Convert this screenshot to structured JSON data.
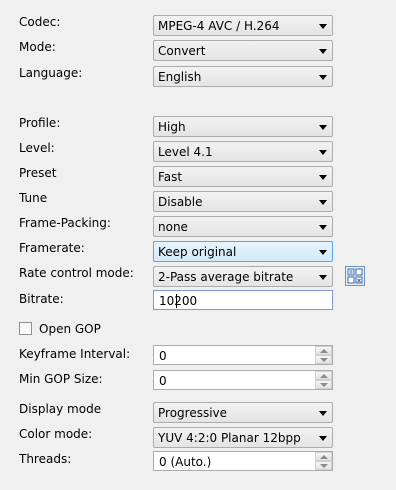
{
  "settings": {
    "codec": {
      "label": "Codec:",
      "value": "MPEG-4 AVC / H.264"
    },
    "mode": {
      "label": "Mode:",
      "value": "Convert"
    },
    "language": {
      "label": "Language:",
      "value": "English"
    },
    "profile": {
      "label": "Profile:",
      "value": "High"
    },
    "level": {
      "label": "Level:",
      "value": "Level 4.1"
    },
    "preset": {
      "label": "Preset",
      "value": "Fast"
    },
    "tune": {
      "label": "Tune",
      "value": "Disable"
    },
    "frame_packing": {
      "label": "Frame-Packing:",
      "value": "none"
    },
    "framerate": {
      "label": "Framerate:",
      "value": "Keep original"
    },
    "rate_control": {
      "label": "Rate control mode:",
      "value": "2-Pass average bitrate"
    },
    "bitrate": {
      "label": "Bitrate:",
      "value": "10200"
    },
    "open_gop": {
      "label": "Open GOP",
      "checked": false
    },
    "keyframe_interval": {
      "label": "Keyframe Interval:",
      "value": "0"
    },
    "min_gop_size": {
      "label": "Min GOP Size:",
      "value": "0"
    },
    "display_mode": {
      "label": "Display mode",
      "value": "Progressive"
    },
    "color_mode": {
      "label": "Color mode:",
      "value": "YUV 4:2:0 Planar 12bpp"
    },
    "threads": {
      "label": "Threads:",
      "value": "0 (Auto.)"
    }
  },
  "colors": {
    "background": "#f0f0f0",
    "highlight": "#d4ebfa",
    "focus_border": "#7a9cd3"
  },
  "icons": {
    "rate_control_settings": "grid-settings-icon"
  }
}
